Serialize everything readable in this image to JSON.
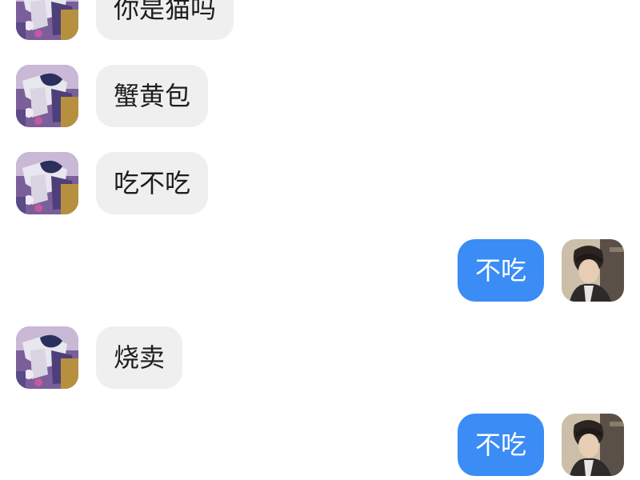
{
  "conversation": {
    "messages": [
      {
        "direction": "incoming",
        "text": "你是猫吗",
        "avatar": "contact-avatar"
      },
      {
        "direction": "incoming",
        "text": "蟹黄包",
        "avatar": "contact-avatar"
      },
      {
        "direction": "incoming",
        "text": "吃不吃",
        "avatar": "contact-avatar"
      },
      {
        "direction": "outgoing",
        "text": "不吃",
        "avatar": "self-avatar"
      },
      {
        "direction": "incoming",
        "text": "烧卖",
        "avatar": "contact-avatar"
      },
      {
        "direction": "outgoing",
        "text": "不吃",
        "avatar": "self-avatar"
      }
    ]
  },
  "colors": {
    "incoming_bubble": "#efefef",
    "outgoing_bubble": "#3b8cf5",
    "incoming_text": "#1e1e1e",
    "outgoing_text": "#ffffff",
    "background": "#ffffff"
  }
}
